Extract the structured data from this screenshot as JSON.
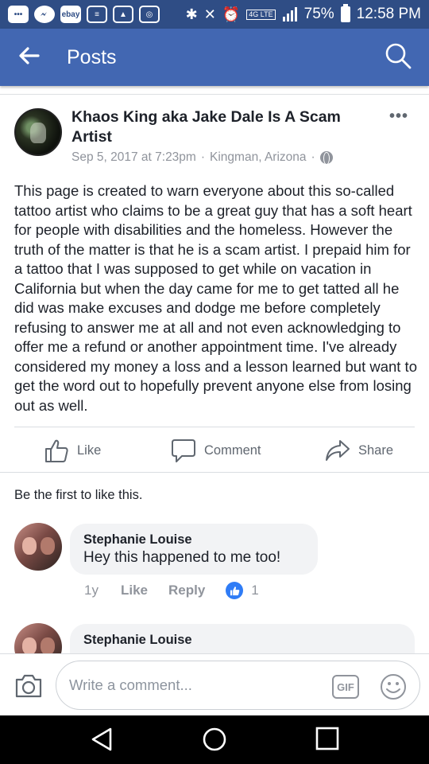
{
  "status_bar": {
    "left_icons": [
      "messages-icon",
      "messenger-icon",
      "ebay-icon",
      "news-icon",
      "gallery-icon",
      "instagram-icon"
    ],
    "ebay_label": "ebay",
    "right_icons": [
      "bluetooth-icon",
      "mute-icon",
      "alarm-icon"
    ],
    "network": "4G LTE",
    "battery": "75%",
    "time": "12:58 PM"
  },
  "header": {
    "title": "Posts"
  },
  "post": {
    "author": "Khaos King aka Jake Dale Is A Scam Artist",
    "date": "Sep 5, 2017 at 7:23pm",
    "location": "Kingman, Arizona",
    "separator": "·",
    "body": "This page is created to warn everyone about this so-called tattoo artist who claims to be a great guy that has a soft heart for people with disabilities and the homeless. However the truth of the matter is that he is a scam artist. I prepaid him for a tattoo that I was supposed to get while on vacation in California but when the day came for me to get tatted all he did was make excuses and dodge me before completely refusing to answer me at all and not even acknowledging to offer me a refund or another appointment time. I've already considered my money a loss and a lesson learned but want to get the word out to hopefully prevent anyone else from losing out as well.",
    "actions": {
      "like": "Like",
      "comment": "Comment",
      "share": "Share"
    }
  },
  "likes_summary": "Be the first to like this.",
  "comments": [
    {
      "name": "Stephanie Louise",
      "text": "Hey this happened to me too!",
      "age": "1y",
      "like_label": "Like",
      "reply_label": "Reply",
      "like_count": "1"
    },
    {
      "name": "Stephanie Louise"
    }
  ],
  "composer": {
    "placeholder": "Write a comment...",
    "gif_label": "GIF"
  },
  "colors": {
    "status_bar": "#2f4d85",
    "header": "#4267b2",
    "like_badge": "#2f7cf6"
  }
}
